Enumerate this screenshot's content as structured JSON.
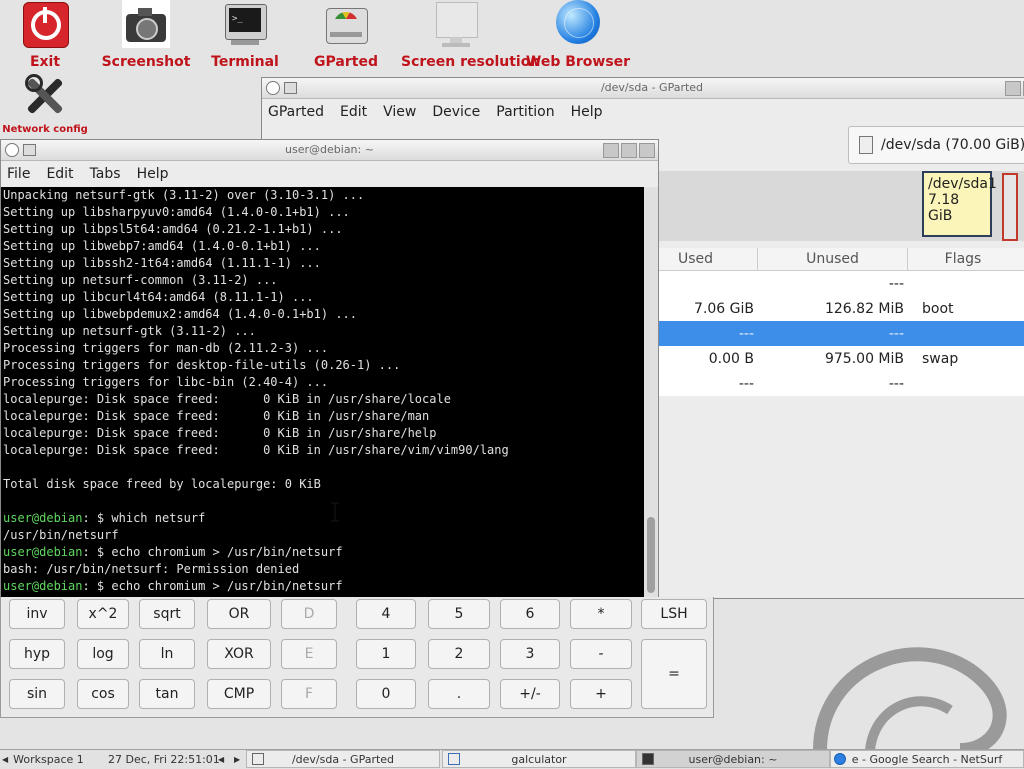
{
  "desktop": {
    "icons": [
      {
        "label": "Exit"
      },
      {
        "label": "Screenshot"
      },
      {
        "label": "Terminal"
      },
      {
        "label": "GParted"
      },
      {
        "label": "Screen resolution"
      },
      {
        "label": "Web Browser"
      },
      {
        "label": "Network config"
      }
    ]
  },
  "gparted": {
    "title": "/dev/sda - GParted",
    "menu": [
      "GParted",
      "Edit",
      "View",
      "Device",
      "Partition",
      "Help"
    ],
    "device_selector": "/dev/sda (70.00 GiB)",
    "partition_block": {
      "name": "/dev/sda1",
      "size": "7.18 GiB"
    },
    "columns": {
      "used": "Used",
      "unused": "Unused",
      "flags": "Flags"
    },
    "rows": [
      {
        "used": "",
        "unused": "---",
        "flags": "",
        "selected": false
      },
      {
        "used": "7.06 GiB",
        "unused": "126.82 MiB",
        "flags": "boot",
        "selected": false
      },
      {
        "used": "---",
        "unused": "---",
        "flags": "",
        "selected": true
      },
      {
        "used": "0.00 B",
        "unused": "975.00 MiB",
        "flags": "swap",
        "selected": false
      },
      {
        "used": "---",
        "unused": "---",
        "flags": "",
        "selected": false
      }
    ]
  },
  "terminal": {
    "title": "user@debian: ~",
    "menu": [
      "File",
      "Edit",
      "Tabs",
      "Help"
    ],
    "lines": [
      "Unpacking netsurf-gtk (3.11-2) over (3.10-3.1) ...",
      "Setting up libsharpyuv0:amd64 (1.4.0-0.1+b1) ...",
      "Setting up libpsl5t64:amd64 (0.21.2-1.1+b1) ...",
      "Setting up libwebp7:amd64 (1.4.0-0.1+b1) ...",
      "Setting up libssh2-1t64:amd64 (1.11.1-1) ...",
      "Setting up netsurf-common (3.11-2) ...",
      "Setting up libcurl4t64:amd64 (8.11.1-1) ...",
      "Setting up libwebpdemux2:amd64 (1.4.0-0.1+b1) ...",
      "Setting up netsurf-gtk (3.11-2) ...",
      "Processing triggers for man-db (2.11.2-3) ...",
      "Processing triggers for desktop-file-utils (0.26-1) ...",
      "Processing triggers for libc-bin (2.40-4) ...",
      "localepurge: Disk space freed:      0 KiB in /usr/share/locale",
      "localepurge: Disk space freed:      0 KiB in /usr/share/man",
      "localepurge: Disk space freed:      0 KiB in /usr/share/help",
      "localepurge: Disk space freed:      0 KiB in /usr/share/vim/vim90/lang",
      "",
      "Total disk space freed by localepurge: 0 KiB",
      ""
    ],
    "prompt_user": "user@debian",
    "prompt_rest": ": $ ",
    "commands": [
      {
        "cmd": "which netsurf",
        "output": "/usr/bin/netsurf"
      },
      {
        "cmd": "echo chromium > /usr/bin/netsurf",
        "output": "bash: /usr/bin/netsurf: Permission denied"
      },
      {
        "cmd": "echo chromium > /usr/bin/netsurf",
        "output": null
      }
    ]
  },
  "calculator": {
    "rows": [
      [
        "inv",
        "x^2",
        "sqrt",
        "OR",
        "D",
        "4",
        "5",
        "6",
        "*",
        "LSH"
      ],
      [
        "hyp",
        "log",
        "ln",
        "XOR",
        "E",
        "1",
        "2",
        "3",
        "-",
        "="
      ],
      [
        "sin",
        "cos",
        "tan",
        "CMP",
        "F",
        "0",
        ".",
        "+/-",
        "+"
      ]
    ],
    "disabled": [
      "D",
      "E",
      "F"
    ]
  },
  "taskbar": {
    "workspace": "Workspace 1",
    "clock": "27 Dec, Fri 22:51:01",
    "tasks": [
      {
        "label": "/dev/sda - GParted"
      },
      {
        "label": "galculator"
      },
      {
        "label": "user@debian: ~"
      },
      {
        "label": "e - Google Search - NetSurf"
      }
    ]
  }
}
